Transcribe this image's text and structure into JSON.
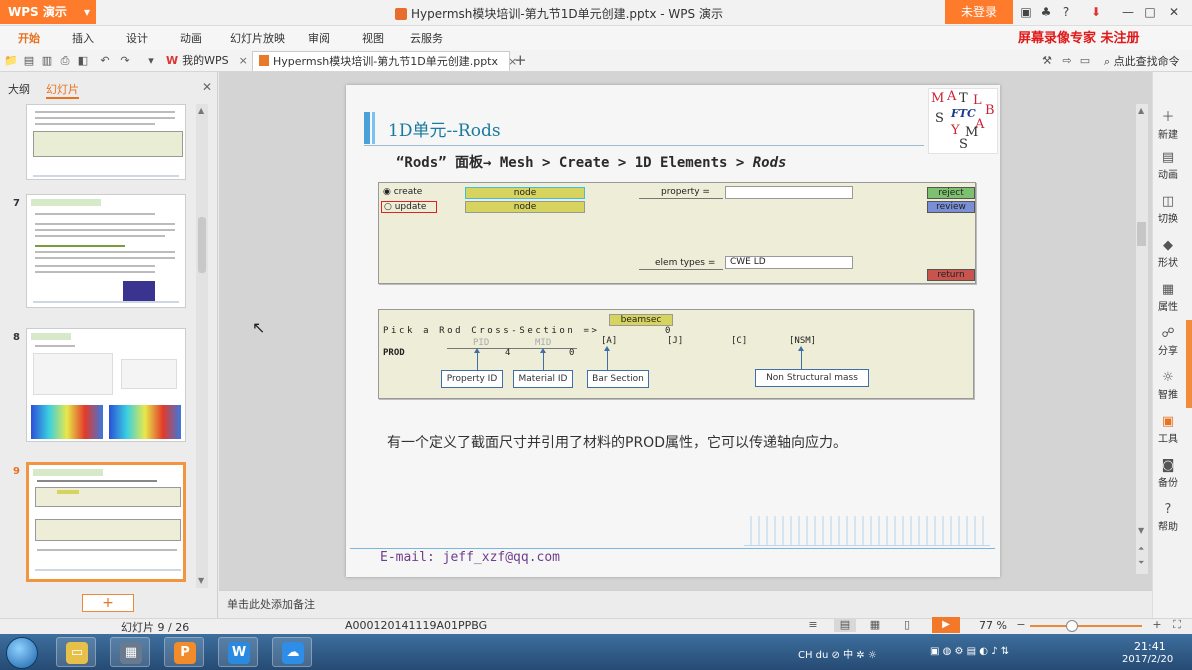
{
  "app": {
    "name": "WPS 演示",
    "doc_title": "Hypermsh模块培训-第九节1D单元创建.pptx - WPS 演示",
    "login": "未登录"
  },
  "menu": {
    "items": [
      "开始",
      "插入",
      "设计",
      "动画",
      "幻灯片放映",
      "审阅",
      "视图",
      "云服务"
    ],
    "recorder": "屏幕录像专家 未注册"
  },
  "tabs": {
    "mywps": "我的WPS",
    "doc": "Hypermsh模块培训-第九节1D单元创建.pptx",
    "find": "点此查找命令"
  },
  "left_panel": {
    "outline_tab": "大纲",
    "slides_tab": "幻灯片",
    "thumb_numbers": [
      "7",
      "8",
      "9"
    ],
    "add_label": "+"
  },
  "slide": {
    "heading": "1D单元--Rods",
    "path_quote": "“Rods”",
    "path_mid": "面板→ Mesh > Create > 1D Elements > ",
    "path_end": "Rods",
    "logo_letters": [
      "M",
      "A",
      "T",
      "L",
      "A",
      "B",
      "S",
      "Y",
      "M",
      "S",
      "FTC"
    ],
    "panel1": {
      "create": "create",
      "update": "update",
      "node1": "node",
      "node2": "node",
      "property_label": "property =",
      "elem_types_label": "elem types =",
      "elem_types_value": "CWE LD",
      "reject": "reject",
      "review": "review",
      "return": "return"
    },
    "panel2": {
      "beamsec": "beamsec",
      "pick_line": "Pick a Rod Cross-Section =>",
      "zero": "0",
      "prod": "PROD",
      "pid": "PID",
      "mid": "MID",
      "four": "4",
      "zero2": "0",
      "a": "[A]",
      "j": "[J]",
      "c": "[C]",
      "nsm": "[NSM]",
      "callouts": [
        "Property ID",
        "Material ID",
        "Bar Section",
        "Non Structural mass"
      ]
    },
    "description": "有一个定义了截面尺寸并引用了材料的PROD属性，它可以传递轴向应力。",
    "email": "E-mail: jeff_xzf@qq.com"
  },
  "right_bar": [
    "新建",
    "动画",
    "切换",
    "形状",
    "属性",
    "分享",
    "智推",
    "工具",
    "备份",
    "帮助"
  ],
  "notes": "单击此处添加备注",
  "status": {
    "slide_count": "幻灯片 9 / 26",
    "code": "A000120141119A01PPBG",
    "zoom": "77 %"
  },
  "taskbar": {
    "tray": "CH  du  ⊘  中  ✲  ☼",
    "time": "21:41",
    "date": "2017/2/20"
  }
}
